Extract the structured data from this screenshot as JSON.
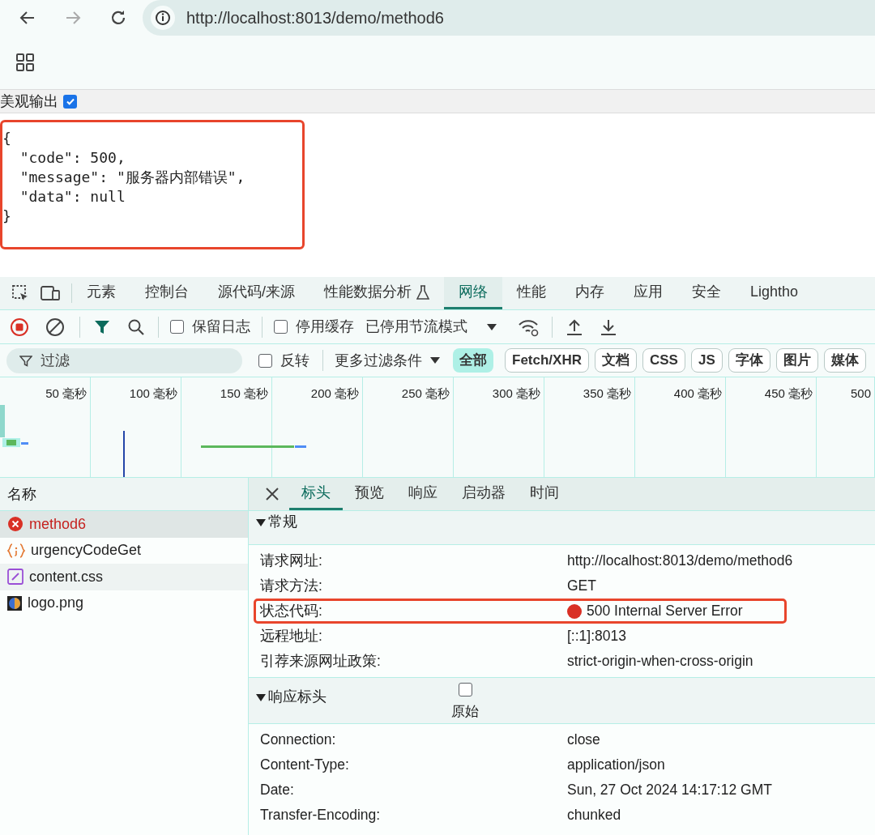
{
  "browser": {
    "url": "http://localhost:8013/demo/method6"
  },
  "page": {
    "pretty_print": {
      "label": "美观输出",
      "checked": true
    },
    "highlighted": true,
    "json_lines": [
      "{",
      "  \"code\": 500,",
      "  \"message\": \"服务器内部错误\",",
      "  \"data\": null",
      "}"
    ]
  },
  "devtools": {
    "tabs": [
      {
        "label": "元素",
        "selected": false
      },
      {
        "label": "控制台",
        "selected": false
      },
      {
        "label": "源代码/来源",
        "selected": false
      },
      {
        "label": "性能数据分析",
        "selected": false,
        "kind": "experiment"
      },
      {
        "label": "网络",
        "selected": true
      },
      {
        "label": "性能",
        "selected": false
      },
      {
        "label": "内存",
        "selected": false
      },
      {
        "label": "应用",
        "selected": false
      },
      {
        "label": "安全",
        "selected": false
      },
      {
        "label": "Lightho",
        "selected": false
      }
    ],
    "toolbar": {
      "preserve_log": {
        "label": "保留日志",
        "checked": false
      },
      "disable_cache": {
        "label": "停用缓存",
        "checked": false
      },
      "throttling": "已停用节流模式"
    },
    "filter": {
      "placeholder": "过滤",
      "invert": {
        "label": "反转",
        "checked": false
      },
      "more_filters": "更多过滤条件",
      "types": [
        {
          "label": "全部",
          "selected": true
        },
        {
          "label": "Fetch/XHR",
          "selected": false
        },
        {
          "label": "文档",
          "selected": false
        },
        {
          "label": "CSS",
          "selected": false
        },
        {
          "label": "JS",
          "selected": false
        },
        {
          "label": "字体",
          "selected": false
        },
        {
          "label": "图片",
          "selected": false
        },
        {
          "label": "媒体",
          "selected": false
        }
      ]
    },
    "timeline": {
      "ticks": [
        "50 毫秒",
        "100 毫秒",
        "150 毫秒",
        "200 毫秒",
        "250 毫秒",
        "300 毫秒",
        "350 毫秒",
        "400 毫秒",
        "450 毫秒",
        "500"
      ]
    },
    "requests": {
      "header": "名称",
      "items": [
        {
          "name": "method6",
          "kind": "error",
          "selected": true
        },
        {
          "name": "urgencyCodeGet",
          "kind": "script",
          "selected": false
        },
        {
          "name": "content.css",
          "kind": "css",
          "selected": false
        },
        {
          "name": "logo.png",
          "kind": "image",
          "selected": false
        }
      ]
    },
    "detail_tabs": [
      {
        "label": "标头",
        "selected": true
      },
      {
        "label": "预览",
        "selected": false
      },
      {
        "label": "响应",
        "selected": false
      },
      {
        "label": "启动器",
        "selected": false
      },
      {
        "label": "时间",
        "selected": false
      }
    ],
    "sections": [
      {
        "title": "常规",
        "expanded": true,
        "rows": [
          {
            "name": "请求网址:",
            "value": "http://localhost:8013/demo/method6",
            "highlighted": false
          },
          {
            "name": "请求方法:",
            "value": "GET",
            "highlighted": false
          },
          {
            "name": "状态代码:",
            "value": "500 Internal Server Error",
            "kind": "status",
            "highlighted": true
          },
          {
            "name": "远程地址:",
            "value": "[::1]:8013",
            "highlighted": false
          },
          {
            "name": "引荐来源网址政策:",
            "value": "strict-origin-when-cross-origin",
            "highlighted": false
          }
        ]
      },
      {
        "title": "响应标头",
        "expanded": true,
        "raw": {
          "label": "原始",
          "checked": false
        },
        "rows": [
          {
            "name": "Connection:",
            "value": "close",
            "highlighted": false
          },
          {
            "name": "Content-Type:",
            "value": "application/json",
            "highlighted": false
          },
          {
            "name": "Date:",
            "value": "Sun, 27 Oct 2024 14:17:12 GMT",
            "highlighted": false
          },
          {
            "name": "Transfer-Encoding:",
            "value": "chunked",
            "highlighted": false
          }
        ]
      }
    ]
  }
}
